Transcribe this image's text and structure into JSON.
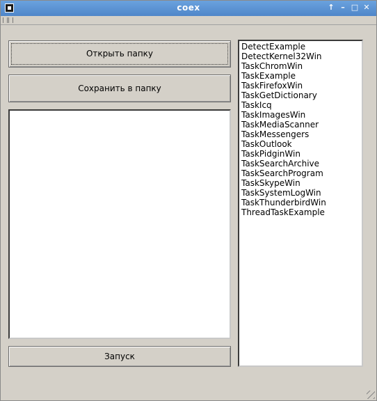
{
  "window": {
    "title": "coex"
  },
  "buttons": {
    "open_folder": "Открыть папку",
    "save_to_folder": "Сохранить в папку",
    "run": "Запуск"
  },
  "task_list": {
    "items": [
      "DetectExample",
      "DetectKernel32Win",
      "TaskChromWin",
      "TaskExample",
      "TaskFirefoxWin",
      "TaskGetDictionary",
      "TaskIcq",
      "TaskImagesWin",
      "TaskMediaScanner",
      "TaskMessengers",
      "TaskOutlook",
      "TaskPidginWin",
      "TaskSearchArchive",
      "TaskSearchProgram",
      "TaskSkypeWin",
      "TaskSystemLogWin",
      "TaskThunderbirdWin",
      "ThreadTaskExample"
    ]
  },
  "colors": {
    "titlebar": "#5a92d4",
    "background": "#d4d0c8"
  }
}
